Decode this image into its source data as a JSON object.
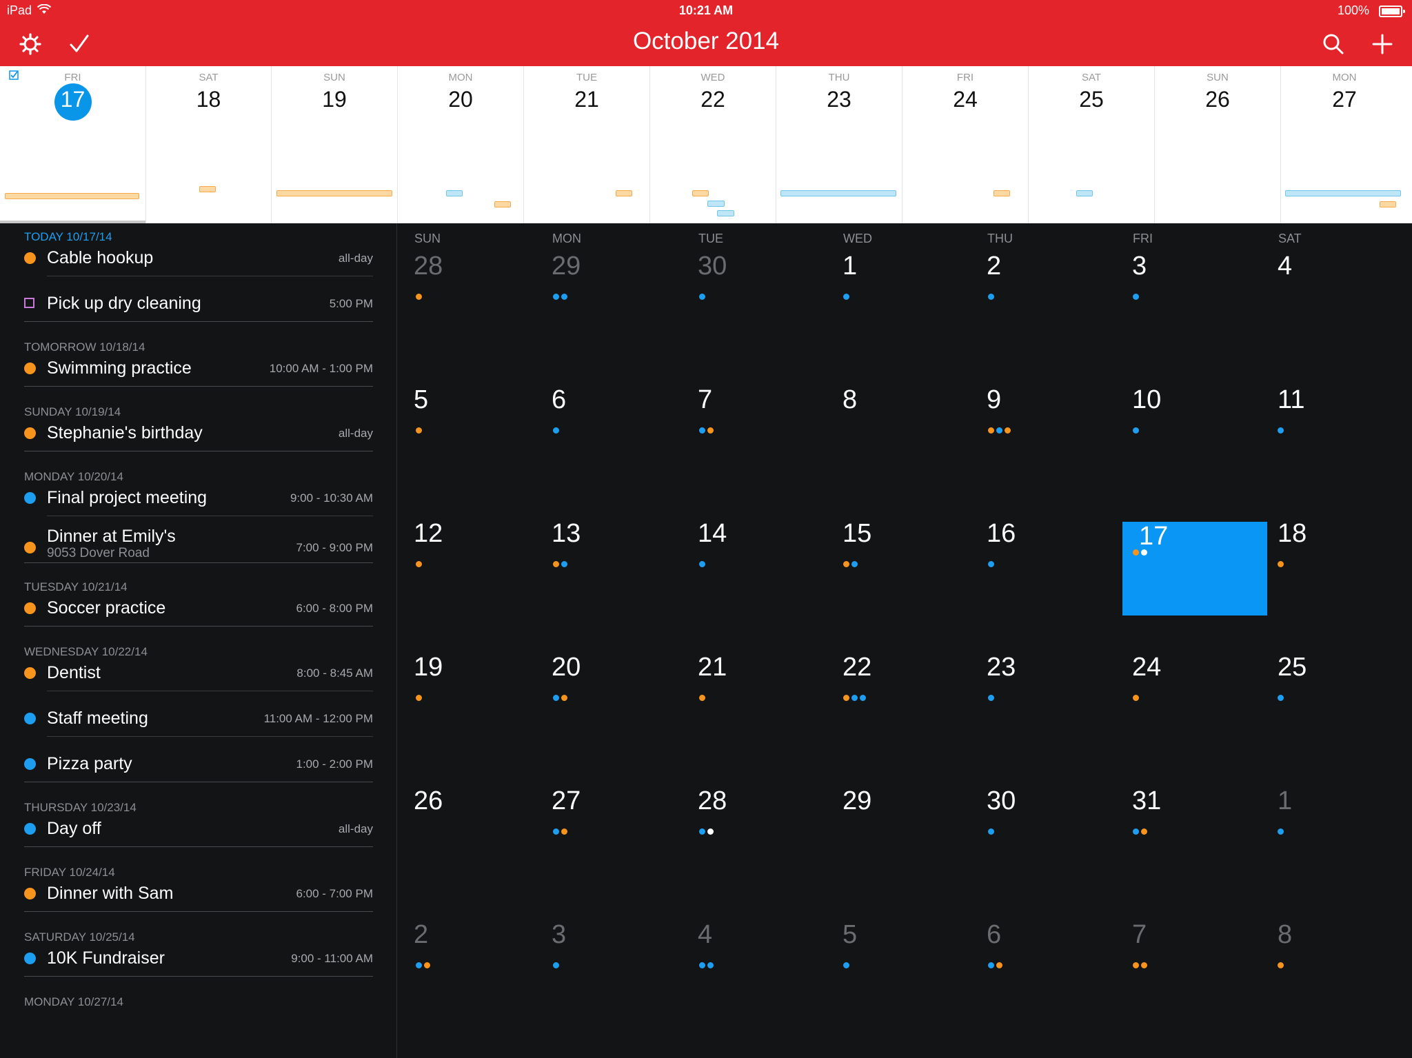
{
  "status_bar": {
    "device": "iPad",
    "time": "10:21 AM",
    "battery": "100%"
  },
  "header": {
    "title": "October 2014"
  },
  "week_strip": [
    {
      "dow": "FRI",
      "day": "17",
      "today": true
    },
    {
      "dow": "SAT",
      "day": "18"
    },
    {
      "dow": "SUN",
      "day": "19"
    },
    {
      "dow": "MON",
      "day": "20"
    },
    {
      "dow": "TUE",
      "day": "21"
    },
    {
      "dow": "WED",
      "day": "22"
    },
    {
      "dow": "THU",
      "day": "23"
    },
    {
      "dow": "FRI",
      "day": "24"
    },
    {
      "dow": "SAT",
      "day": "25"
    },
    {
      "dow": "SUN",
      "day": "26"
    },
    {
      "dow": "MON",
      "day": "27"
    }
  ],
  "agenda": {
    "sections": [
      {
        "label": "TODAY 10/17/14",
        "today": true,
        "events": [
          {
            "title": "Cable hookup",
            "time": "all-day",
            "color": "orange"
          },
          {
            "title": "Pick up dry cleaning",
            "time": "5:00 PM",
            "color": "purple-task"
          }
        ]
      },
      {
        "label": "TOMORROW 10/18/14",
        "events": [
          {
            "title": "Swimming practice",
            "time": "10:00 AM - 1:00 PM",
            "color": "orange"
          }
        ]
      },
      {
        "label": "SUNDAY 10/19/14",
        "events": [
          {
            "title": "Stephanie's birthday",
            "time": "all-day",
            "color": "orange"
          }
        ]
      },
      {
        "label": "MONDAY 10/20/14",
        "events": [
          {
            "title": "Final project meeting",
            "time": "9:00 - 10:30 AM",
            "color": "blue"
          },
          {
            "title": "Dinner at Emily's",
            "subtitle": "9053 Dover Road",
            "time": "7:00 - 9:00 PM",
            "color": "orange"
          }
        ]
      },
      {
        "label": "TUESDAY 10/21/14",
        "events": [
          {
            "title": "Soccer practice",
            "time": "6:00 - 8:00 PM",
            "color": "orange"
          }
        ]
      },
      {
        "label": "WEDNESDAY 10/22/14",
        "events": [
          {
            "title": "Dentist",
            "time": "8:00 - 8:45 AM",
            "color": "orange"
          },
          {
            "title": "Staff meeting",
            "time": "11:00 AM - 12:00 PM",
            "color": "blue"
          },
          {
            "title": "Pizza party",
            "time": "1:00 - 2:00 PM",
            "color": "blue"
          }
        ]
      },
      {
        "label": "THURSDAY 10/23/14",
        "events": [
          {
            "title": "Day off",
            "time": "all-day",
            "color": "blue"
          }
        ]
      },
      {
        "label": "FRIDAY 10/24/14",
        "events": [
          {
            "title": "Dinner with Sam",
            "time": "6:00 - 7:00 PM",
            "color": "orange"
          }
        ]
      },
      {
        "label": "SATURDAY 10/25/14",
        "events": [
          {
            "title": "10K Fundraiser",
            "time": "9:00 - 11:00 AM",
            "color": "blue"
          }
        ]
      },
      {
        "label": "MONDAY 10/27/14",
        "events": []
      }
    ]
  },
  "month": {
    "weekdays": [
      "SUN",
      "MON",
      "TUE",
      "WED",
      "THU",
      "FRI",
      "SAT"
    ],
    "weeks": [
      [
        {
          "n": "28",
          "dim": true,
          "dots": "o"
        },
        {
          "n": "29",
          "dim": true,
          "dots": "bb"
        },
        {
          "n": "30",
          "dim": true,
          "dots": "b"
        },
        {
          "n": "1",
          "dots": "b"
        },
        {
          "n": "2",
          "dots": "b"
        },
        {
          "n": "3",
          "dots": "b"
        },
        {
          "n": "4",
          "dots": ""
        }
      ],
      [
        {
          "n": "5",
          "dots": "o"
        },
        {
          "n": "6",
          "dots": "b"
        },
        {
          "n": "7",
          "dots": "bo"
        },
        {
          "n": "8",
          "dots": ""
        },
        {
          "n": "9",
          "dots": "obo"
        },
        {
          "n": "10",
          "dots": "b"
        },
        {
          "n": "11",
          "dots": "b"
        }
      ],
      [
        {
          "n": "12",
          "dots": "o"
        },
        {
          "n": "13",
          "dots": "ob"
        },
        {
          "n": "14",
          "dots": "b"
        },
        {
          "n": "15",
          "dots": "ob"
        },
        {
          "n": "16",
          "dots": "b"
        },
        {
          "n": "17",
          "sel": true,
          "dots": "oc"
        },
        {
          "n": "18",
          "dots": "o"
        }
      ],
      [
        {
          "n": "19",
          "dots": "o"
        },
        {
          "n": "20",
          "dots": "bo"
        },
        {
          "n": "21",
          "dots": "o"
        },
        {
          "n": "22",
          "dots": "obb"
        },
        {
          "n": "23",
          "dots": "b"
        },
        {
          "n": "24",
          "dots": "o"
        },
        {
          "n": "25",
          "dots": "b"
        }
      ],
      [
        {
          "n": "26",
          "dots": ""
        },
        {
          "n": "27",
          "dots": "bo"
        },
        {
          "n": "28",
          "dots": "bc"
        },
        {
          "n": "29",
          "dots": ""
        },
        {
          "n": "30",
          "dots": "b"
        },
        {
          "n": "31",
          "dots": "bo"
        },
        {
          "n": "1",
          "dim": true,
          "dots": "b"
        }
      ],
      [
        {
          "n": "2",
          "dim": true,
          "dots": "bo"
        },
        {
          "n": "3",
          "dim": true,
          "dots": "b"
        },
        {
          "n": "4",
          "dim": true,
          "dots": "bb"
        },
        {
          "n": "5",
          "dim": true,
          "dots": "b"
        },
        {
          "n": "6",
          "dim": true,
          "dots": "bo"
        },
        {
          "n": "7",
          "dim": true,
          "dots": "oo"
        },
        {
          "n": "8",
          "dim": true,
          "dots": "o"
        }
      ]
    ]
  },
  "colors": {
    "accent_red": "#e3242b",
    "today_blue": "#0a96f5",
    "event_orange": "#f7941d",
    "event_blue": "#1e9ef0"
  }
}
